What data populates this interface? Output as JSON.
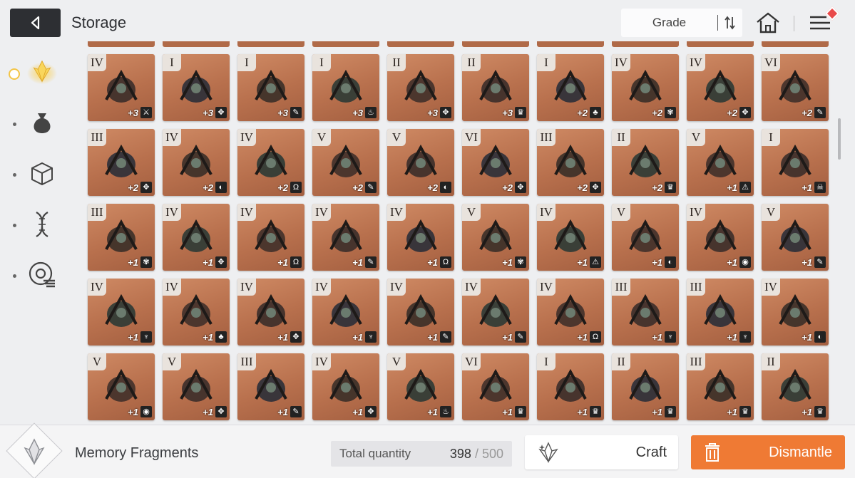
{
  "header": {
    "title": "Storage",
    "sort_label": "Grade"
  },
  "sidebar": {
    "items": [
      {
        "icon": "memory-fragment-icon",
        "active": true
      },
      {
        "icon": "bag-icon",
        "active": false
      },
      {
        "icon": "cube-icon",
        "active": false
      },
      {
        "icon": "dna-icon",
        "active": false
      },
      {
        "icon": "gear-disc-icon",
        "active": false
      }
    ]
  },
  "grid": {
    "rows": [
      [
        {
          "grade": "IV",
          "plus": "+3",
          "type": "⚔"
        },
        {
          "grade": "I",
          "plus": "+3",
          "type": "✥"
        },
        {
          "grade": "I",
          "plus": "+3",
          "type": "✎"
        },
        {
          "grade": "I",
          "plus": "+3",
          "type": "♨"
        },
        {
          "grade": "II",
          "plus": "+3",
          "type": "✥"
        },
        {
          "grade": "II",
          "plus": "+3",
          "type": "♛"
        },
        {
          "grade": "I",
          "plus": "+2",
          "type": "♣"
        },
        {
          "grade": "IV",
          "plus": "+2",
          "type": "✾"
        },
        {
          "grade": "IV",
          "plus": "+2",
          "type": "✥"
        },
        {
          "grade": "VI",
          "plus": "+2",
          "type": "✎"
        }
      ],
      [
        {
          "grade": "III",
          "plus": "+2",
          "type": "✥"
        },
        {
          "grade": "IV",
          "plus": "+2",
          "type": "◐"
        },
        {
          "grade": "IV",
          "plus": "+2",
          "type": "Ω"
        },
        {
          "grade": "V",
          "plus": "+2",
          "type": "✎"
        },
        {
          "grade": "V",
          "plus": "+2",
          "type": "◐"
        },
        {
          "grade": "VI",
          "plus": "+2",
          "type": "✥"
        },
        {
          "grade": "III",
          "plus": "+2",
          "type": "✥"
        },
        {
          "grade": "II",
          "plus": "+2",
          "type": "♛"
        },
        {
          "grade": "V",
          "plus": "+1",
          "type": "⚠"
        },
        {
          "grade": "I",
          "plus": "+1",
          "type": "☠"
        }
      ],
      [
        {
          "grade": "III",
          "plus": "+1",
          "type": "✾"
        },
        {
          "grade": "IV",
          "plus": "+1",
          "type": "✥"
        },
        {
          "grade": "IV",
          "plus": "+1",
          "type": "Ω"
        },
        {
          "grade": "IV",
          "plus": "+1",
          "type": "✎"
        },
        {
          "grade": "IV",
          "plus": "+1",
          "type": "Ω"
        },
        {
          "grade": "V",
          "plus": "+1",
          "type": "✾"
        },
        {
          "grade": "IV",
          "plus": "+1",
          "type": "⚠"
        },
        {
          "grade": "V",
          "plus": "+1",
          "type": "◐"
        },
        {
          "grade": "IV",
          "plus": "+1",
          "type": "◉"
        },
        {
          "grade": "V",
          "plus": "+1",
          "type": "✎"
        }
      ],
      [
        {
          "grade": "IV",
          "plus": "+1",
          "type": "♆"
        },
        {
          "grade": "IV",
          "plus": "+1",
          "type": "♣"
        },
        {
          "grade": "IV",
          "plus": "+1",
          "type": "✥"
        },
        {
          "grade": "IV",
          "plus": "+1",
          "type": "♆"
        },
        {
          "grade": "IV",
          "plus": "+1",
          "type": "✎"
        },
        {
          "grade": "IV",
          "plus": "+1",
          "type": "✎"
        },
        {
          "grade": "IV",
          "plus": "+1",
          "type": "Ω"
        },
        {
          "grade": "III",
          "plus": "+1",
          "type": "♆"
        },
        {
          "grade": "III",
          "plus": "+1",
          "type": "♆"
        },
        {
          "grade": "IV",
          "plus": "+1",
          "type": "◐"
        }
      ],
      [
        {
          "grade": "V",
          "plus": "+1",
          "type": "◉"
        },
        {
          "grade": "V",
          "plus": "+1",
          "type": "✥"
        },
        {
          "grade": "III",
          "plus": "+1",
          "type": "✎"
        },
        {
          "grade": "IV",
          "plus": "+1",
          "type": "✥"
        },
        {
          "grade": "V",
          "plus": "+1",
          "type": "♨"
        },
        {
          "grade": "VI",
          "plus": "+1",
          "type": "♛"
        },
        {
          "grade": "I",
          "plus": "+1",
          "type": "♛"
        },
        {
          "grade": "II",
          "plus": "+1",
          "type": "♛"
        },
        {
          "grade": "III",
          "plus": "+1",
          "type": "♛"
        },
        {
          "grade": "II",
          "plus": "+1",
          "type": "♛"
        }
      ]
    ]
  },
  "footer": {
    "fragment_label": "Memory Fragments",
    "qty_label": "Total quantity",
    "qty_current": "398",
    "qty_max": " / 500",
    "craft_label": "Craft",
    "dismantle_label": "Dismantle"
  },
  "colors": {
    "accent": "#ef7a34",
    "card": "#b8704d",
    "active": "#f3c547"
  }
}
